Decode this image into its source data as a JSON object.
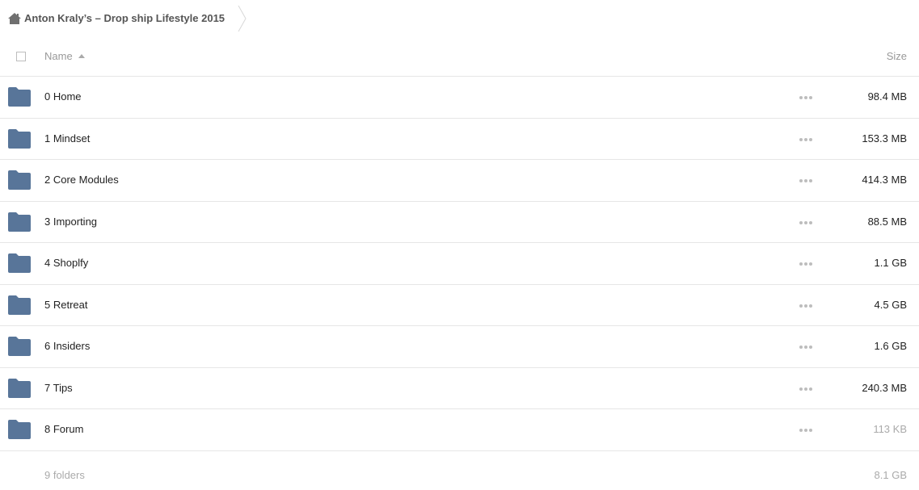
{
  "breadcrumb": {
    "home_icon": "home-icon",
    "title": "Anton Kraly’s – Drop ship Lifestyle 2015"
  },
  "header": {
    "name_label": "Name",
    "sort_direction": "ascending",
    "size_label": "Size"
  },
  "folders": [
    {
      "name": "0 Home",
      "size": "98.4 MB"
    },
    {
      "name": "1 Mindset",
      "size": "153.3 MB"
    },
    {
      "name": "2 Core Modules",
      "size": "414.3 MB"
    },
    {
      "name": "3 Importing",
      "size": "88.5 MB"
    },
    {
      "name": "4 Shoplfy",
      "size": "1.1 GB"
    },
    {
      "name": "5 Retreat",
      "size": "4.5 GB"
    },
    {
      "name": "6 Insiders",
      "size": "1.6 GB"
    },
    {
      "name": "7 Tips",
      "size": "240.3 MB"
    },
    {
      "name": "8 Forum",
      "size": "113 KB"
    }
  ],
  "footer": {
    "count": "9 folders",
    "total": "8.1 GB"
  },
  "colors": {
    "folder": "#587599",
    "muted_text": "#aaaaaa",
    "divider": "#e6e6e6"
  }
}
